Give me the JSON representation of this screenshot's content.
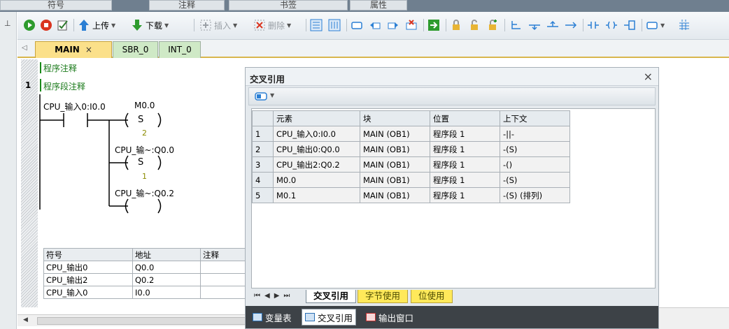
{
  "top_panes": [
    "符号",
    "注释",
    "书签",
    "属性"
  ],
  "toolbar": {
    "upload_label": "上传",
    "download_label": "下载",
    "insert_label": "插入",
    "delete_label": "删除"
  },
  "editor_tabs": [
    {
      "label": "MAIN",
      "close": "×"
    },
    {
      "label": "SBR_0"
    },
    {
      "label": "INT_0"
    }
  ],
  "editor": {
    "program_comment": "程序注释",
    "segment_number": "1",
    "segment_comment": "程序段注释",
    "contact_label": "CPU_输入0:I0.0",
    "coil1_address": "M0.0",
    "coil1_type": "S",
    "coil1_count": "2",
    "coil2_address": "CPU_输~:Q0.0",
    "coil2_type": "S",
    "coil2_count": "1",
    "coil3_address": "CPU_输~:Q0.2"
  },
  "symbol_table": {
    "headers": [
      "符号",
      "地址",
      "注释"
    ],
    "rows": [
      [
        "CPU_输出0",
        "Q0.0",
        ""
      ],
      [
        "CPU_输出2",
        "Q0.2",
        ""
      ],
      [
        "CPU_输入0",
        "I0.0",
        ""
      ]
    ]
  },
  "cross_ref": {
    "title": "交叉引用",
    "close": "×",
    "headers": [
      "元素",
      "块",
      "位置",
      "上下文"
    ],
    "rows": [
      [
        "1",
        "CPU_输入0:I0.0",
        "MAIN (OB1)",
        "程序段 1",
        "-||-"
      ],
      [
        "2",
        "CPU_输出0:Q0.0",
        "MAIN (OB1)",
        "程序段 1",
        "-(S)"
      ],
      [
        "3",
        "CPU_输出2:Q0.2",
        "MAIN (OB1)",
        "程序段 1",
        "-()"
      ],
      [
        "4",
        "M0.0",
        "MAIN (OB1)",
        "程序段 1",
        "-(S)"
      ],
      [
        "5",
        "M0.1",
        "MAIN (OB1)",
        "程序段 1",
        "-(S) (排列)"
      ]
    ],
    "sheet_tabs": [
      "交叉引用",
      "字节使用",
      "位使用"
    ],
    "bottom_tabs": [
      "变量表",
      "交叉引用",
      "输出窗口"
    ]
  },
  "colors": {
    "active_tab": "#fbe08a",
    "inactive_tab": "#cfe9c6",
    "comment_green": "#1a7a1a",
    "bottom_bar": "#3d4247",
    "yellow_tab": "#ffe95a"
  }
}
